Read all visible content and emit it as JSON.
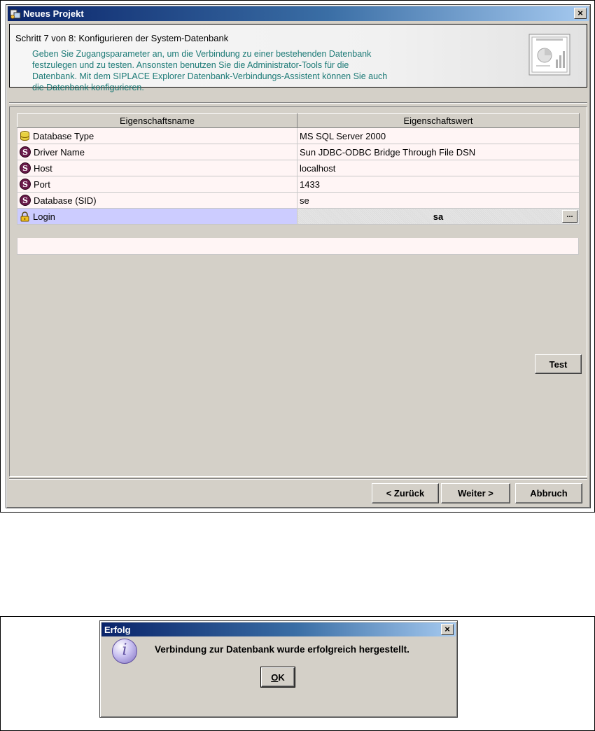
{
  "main_window": {
    "title": "Neues Projekt",
    "close_glyph": "×",
    "header": {
      "step": "Schritt 7 von 8: Konfigurieren der System-Datenbank",
      "description_lines": [
        "Geben Sie Zugangsparameter an, um die Verbindung zu einer bestehenden Datenbank",
        "festzulegen und zu testen. Ansonsten benutzen Sie die Administrator-Tools für die",
        "Datenbank. Mit dem SIPLACE Explorer Datenbank-Verbindungs-Assistent können Sie auch",
        "die Datenbank konfigurieren."
      ]
    },
    "table": {
      "columns": [
        "Eigenschaftsname",
        "Eigenschaftswert"
      ],
      "rows": [
        {
          "icon": "database-icon",
          "name": "Database Type",
          "value": "MS SQL Server 2000"
        },
        {
          "icon": "s-property-icon",
          "name": "Driver Name",
          "value": "Sun JDBC-ODBC Bridge Through File DSN"
        },
        {
          "icon": "s-property-icon",
          "name": "Host",
          "value": "localhost"
        },
        {
          "icon": "s-property-icon",
          "name": "Port",
          "value": "1433"
        },
        {
          "icon": "s-property-icon",
          "name": "Database (SID)",
          "value": "se"
        },
        {
          "icon": "lock-icon",
          "name": "Login",
          "value": "sa",
          "selected": true
        }
      ],
      "ellipsis_label": "..."
    },
    "test_label": "Test",
    "back_label": "< Zurück",
    "next_label": "Weiter >",
    "cancel_label": "Abbruch"
  },
  "dialog": {
    "title": "Erfolg",
    "close_glyph": "×",
    "info_glyph": "i",
    "message": "Verbindung zur Datenbank wurde erfolgreich hergestellt.",
    "ok_mnemonic": "O",
    "ok_rest": "K"
  },
  "colors": {
    "title_gradient_start": "#0a246a",
    "title_gradient_end": "#a6caf0",
    "description_text": "#1c7a76",
    "selected_row": "#ccccff",
    "row_background": "#fff5f5",
    "window_face": "#d4d0c8"
  }
}
